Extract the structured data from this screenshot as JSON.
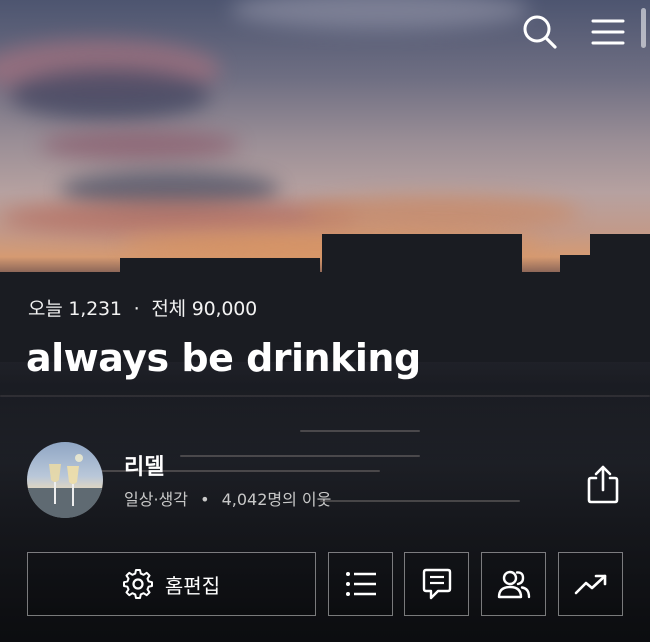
{
  "header": {
    "search_icon": "search-icon",
    "menu_icon": "hamburger-menu-icon"
  },
  "blog": {
    "today_label": "오늘",
    "today_count": "1,231",
    "dot": "·",
    "total_label": "전체",
    "total_count": "90,000",
    "title": "always be drinking"
  },
  "profile": {
    "nickname": "리델",
    "category": "일상·생각",
    "bullet": "•",
    "neighbors": "4,042명의 이웃",
    "share_icon": "share-icon"
  },
  "actions": {
    "edit_home_label": "홈편집",
    "edit_icon": "gear-icon",
    "list_icon": "list-icon",
    "comment_icon": "comment-icon",
    "neighbors_icon": "people-icon",
    "stats_icon": "trending-up-icon"
  },
  "colors": {
    "text_primary": "#ffffff",
    "text_secondary": "#c8c8c8",
    "button_border": "#ffffff73"
  }
}
